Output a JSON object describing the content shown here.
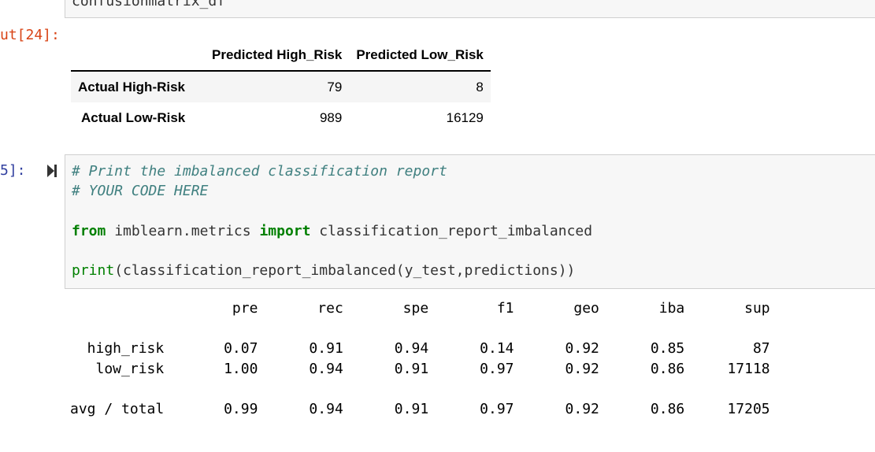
{
  "prev_cell": {
    "code": "confusionmatrix_df"
  },
  "out_prompt": "ut[24]:",
  "in_prompt": "5]:",
  "run_icon": "run-cell-icon",
  "dataframe": {
    "columns": [
      "Predicted High_Risk",
      "Predicted Low_Risk"
    ],
    "rows": [
      {
        "label": "Actual High-Risk",
        "values": [
          "79",
          "8"
        ]
      },
      {
        "label": "Actual Low-Risk",
        "values": [
          "989",
          "16129"
        ]
      }
    ]
  },
  "code_cell": {
    "comment1": "# Print the imbalanced classification report",
    "comment2": "# YOUR CODE HERE",
    "kw_from": "from",
    "module": " imblearn.metrics ",
    "kw_import": "import",
    "imported": " classification_report_imbalanced",
    "fn_print": "print",
    "call": "(classification_report_imbalanced(y_test,predictions))"
  },
  "report": {
    "text": "                   pre       rec       spe        f1       geo       iba       sup\n\n  high_risk       0.07      0.91      0.94      0.14      0.92      0.85        87\n   low_risk       1.00      0.94      0.91      0.97      0.92      0.86     17118\n\navg / total       0.99      0.94      0.91      0.97      0.92      0.86     17205"
  },
  "colors": {
    "out_prompt": "#d84315",
    "in_prompt": "#303f9f",
    "keyword": "#008000",
    "comment": "#408080",
    "cell_bg": "#f7f7f7"
  }
}
